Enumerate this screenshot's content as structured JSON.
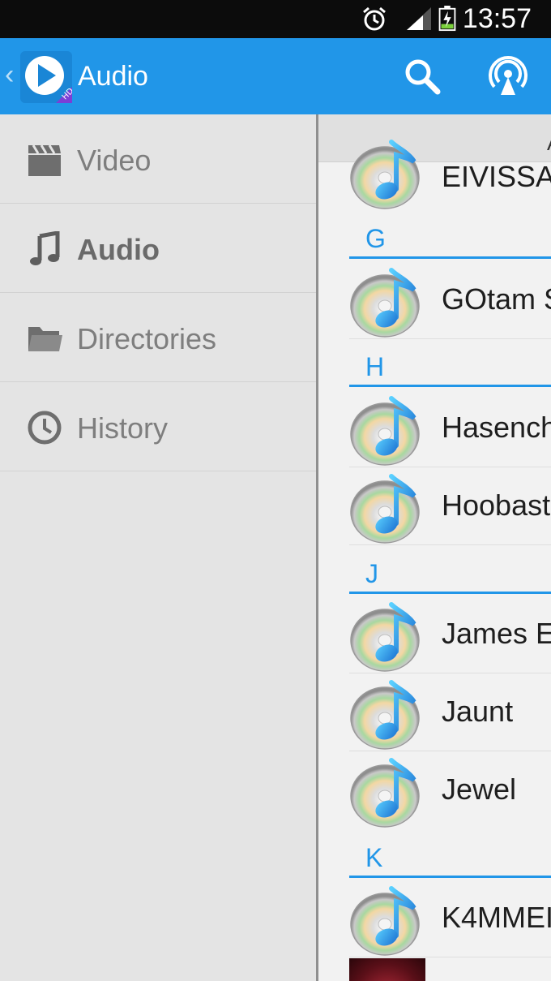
{
  "status_bar": {
    "time": "13:57",
    "icons": [
      "alarm-icon",
      "signal-icon",
      "battery-charging-icon"
    ]
  },
  "app_bar": {
    "title": "Audio",
    "actions": [
      "search-icon",
      "cast-icon"
    ]
  },
  "drawer": {
    "items": [
      {
        "label": "Video",
        "icon": "video-icon",
        "active": false
      },
      {
        "label": "Audio",
        "icon": "music-note-icon",
        "active": true
      },
      {
        "label": "Directories",
        "icon": "folder-icon",
        "active": false
      },
      {
        "label": "History",
        "icon": "clock-icon",
        "active": false
      }
    ]
  },
  "content": {
    "header_label": "A",
    "list": [
      {
        "type": "item",
        "name": "EIVISSA"
      },
      {
        "type": "section",
        "letter": "G"
      },
      {
        "type": "item",
        "name": "GOtam S"
      },
      {
        "type": "section",
        "letter": "H"
      },
      {
        "type": "item",
        "name": "Hasench"
      },
      {
        "type": "item",
        "name": "Hoobast"
      },
      {
        "type": "section",
        "letter": "J"
      },
      {
        "type": "item",
        "name": "James E"
      },
      {
        "type": "item",
        "name": "Jaunt"
      },
      {
        "type": "item",
        "name": "Jewel"
      },
      {
        "type": "section",
        "letter": "K"
      },
      {
        "type": "item",
        "name": "K4MMEI"
      }
    ]
  },
  "colors": {
    "accent": "#2196e8",
    "status_bar": "#0c0c0c",
    "drawer_bg": "#e4e4e4"
  }
}
